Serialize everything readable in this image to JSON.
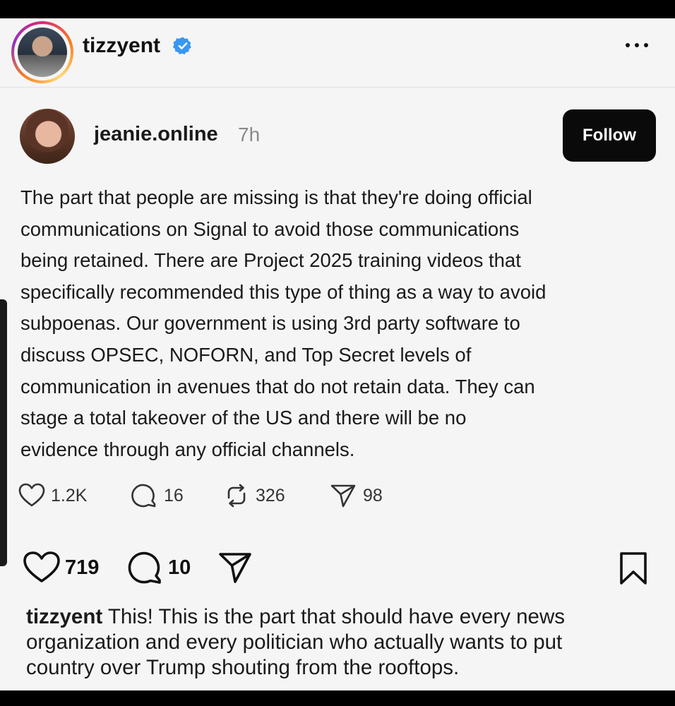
{
  "header": {
    "username": "tizzyent",
    "verified_icon": "verified-badge-icon",
    "more_icon": "more-icon"
  },
  "thread_post": {
    "username": "jeanie.online",
    "time": "7h",
    "follow_label": "Follow",
    "body_lines": [
      "The part that people are missing is that they're doing official",
      "communications on Signal to avoid those communications",
      "being retained. There are Project 2025 training videos that",
      "specifically recommended this type of thing as a way to avoid",
      "subpoenas. Our government is using 3rd party software to",
      "discuss OPSEC, NOFORN, and Top Secret levels of",
      "communication in avenues that do not retain data. They can",
      "stage a total takeover of the US and there will be no",
      "evidence through any official channels."
    ],
    "likes": "1.2K",
    "replies": "16",
    "reposts": "326",
    "shares": "98"
  },
  "post_actions": {
    "likes": "719",
    "comments": "10"
  },
  "caption": {
    "username": "tizzyent",
    "first_line": "This! This is the part that should have every news",
    "line2": "organization and every politician who actually wants to put",
    "line3": "country over Trump shouting from the rooftops."
  },
  "colors": {
    "background": "#f5f5f5",
    "verified": "#3897f0",
    "follow_button": "#0a0a0a"
  }
}
